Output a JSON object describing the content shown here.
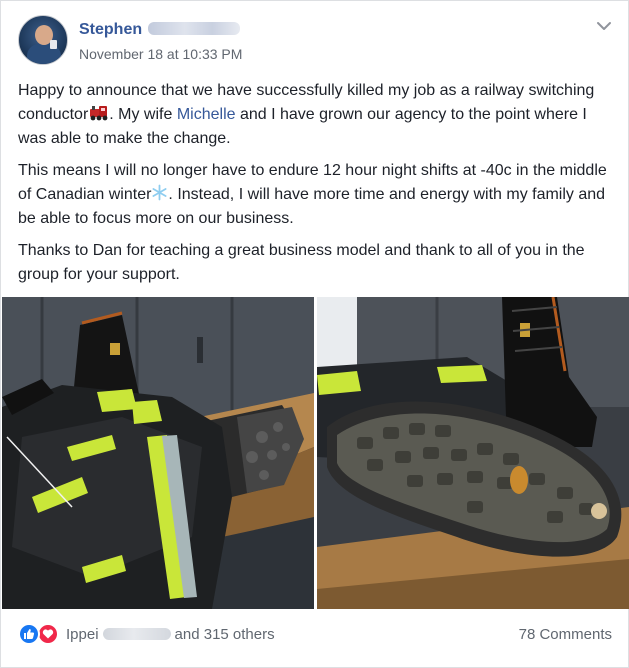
{
  "post": {
    "author_first_name": "Stephen",
    "timestamp": "November 18 at 10:33 PM",
    "paragraph1": {
      "part1": "Happy to announce that we have successfully killed my job as a railway switching conductor",
      "emoji1": "train-emoji",
      "part2": ". My wife ",
      "mention": "Michelle",
      "part3": " and I have grown our agency to the point where I was able to make the change."
    },
    "paragraph2": {
      "part1": "This means I will no longer have to endure 12 hour night shifts at -40c in the middle of Canadian winter",
      "emoji1": "snowflake-emoji",
      "part2": ". Instead, I will have more time and energy with my family and be able to focus more on our business."
    },
    "paragraph3": "Thanks to Dan for teaching a great business model and thank to all of you in the group for your support.",
    "photos": [
      "boots-on-bench-photo",
      "boot-soles-photo"
    ]
  },
  "footer": {
    "reactor_first_name": "Ippei",
    "others_text": "and 315 others",
    "comments_text": "78 Comments",
    "reactions": [
      "like-icon",
      "love-icon"
    ]
  },
  "colors": {
    "link": "#365899",
    "meta": "#616770",
    "like": "#1877f2",
    "love": "#f0284a",
    "hi_vis": "#c9e639"
  }
}
